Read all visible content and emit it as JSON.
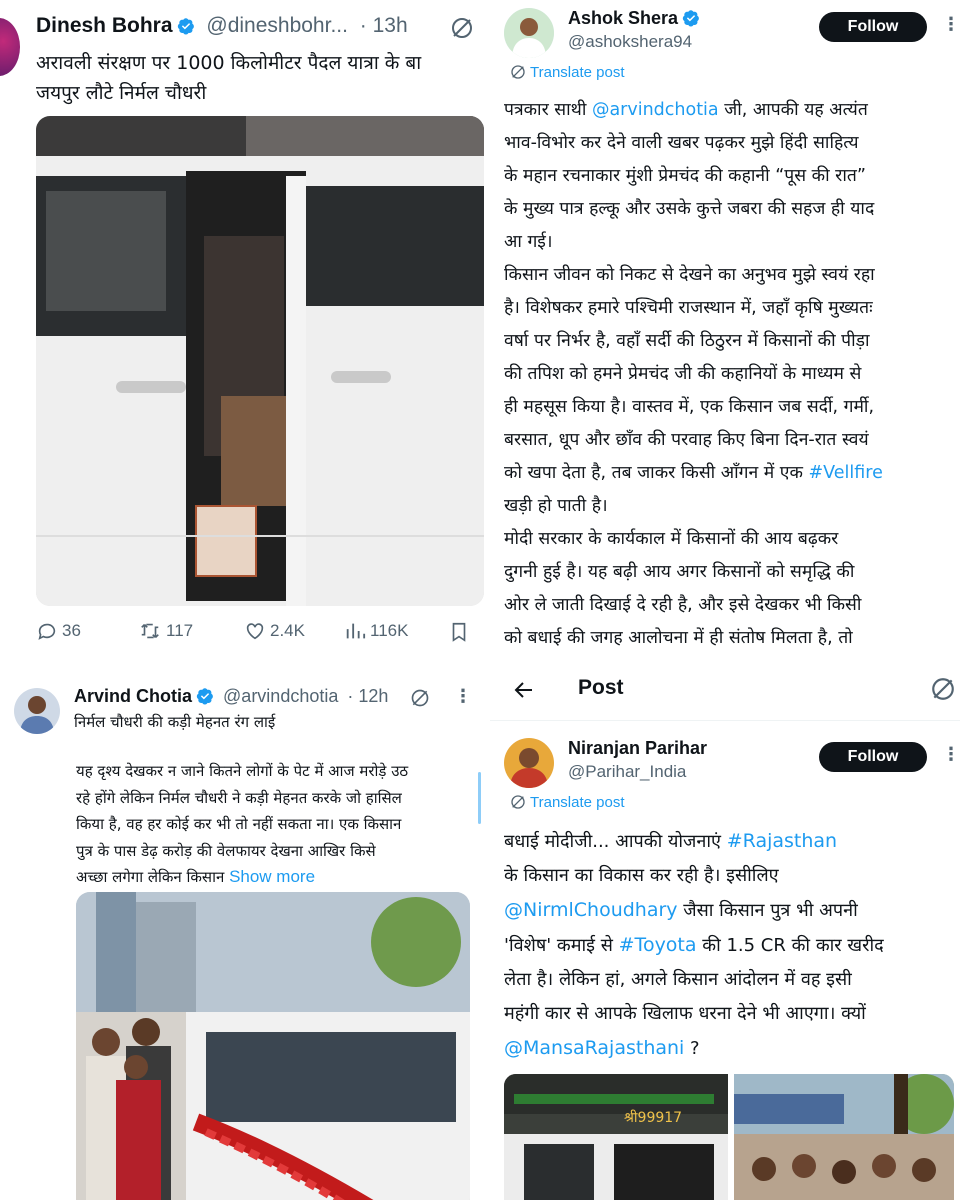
{
  "tweet1": {
    "name": "Dinesh Bohra",
    "handle": "@dineshbohr...",
    "time": "· 13h",
    "text_line1": "अरावली संरक्षण पर 1000 किलोमीटर पैदल यात्रा के बा",
    "text_line2": "जयपुर लौटे निर्मल चौधरी",
    "replies": "36",
    "reposts": "117",
    "likes": "2.4K",
    "views": "116K"
  },
  "tweet2": {
    "name": "Ashok Shera",
    "handle": "@ashokshera94",
    "follow": "Follow",
    "translate": "Translate post",
    "p1_l1_a": "पत्रकार साथी ",
    "p1_l1_link": "@arvindchotia",
    "p1_l1_b": " जी, आपकी यह अत्यंत",
    "p1_l2": "भाव-विभोर कर देने वाली खबर पढ़कर मुझे हिंदी साहित्य",
    "p1_l3": "के महान रचनाकार मुंशी प्रेमचंद की कहानी “पूस की रात”",
    "p1_l4": "के मुख्य पात्र हल्कू और उसके कुत्ते जबरा की सहज ही याद",
    "p1_l5": "आ गई।",
    "p2_l1": "किसान जीवन को निकट से देखने का अनुभव मुझे स्वयं रहा",
    "p2_l2": "है। विशेषकर हमारे पश्चिमी राजस्थान में, जहाँ कृषि मुख्यतः",
    "p2_l3": "वर्षा पर निर्भर है, वहाँ सर्दी की ठिठुरन में किसानों की पीड़ा",
    "p2_l4": "की तपिश को हमने प्रेमचंद जी की कहानियों के माध्यम से",
    "p2_l5": "ही महसूस किया है। वास्तव में, एक किसान जब सर्दी, गर्मी,",
    "p2_l6": "बरसात, धूप और छाँव की परवाह किए बिना दिन-रात स्वयं",
    "p2_l7_a": "को खपा देता है, तब जाकर किसी आँगन में एक ",
    "p2_l7_link": "#Vellfire",
    "p2_l8": "खड़ी हो पाती है।",
    "p3_l1": " मोदी सरकार के कार्यकाल में किसानों की आय बढ़कर",
    "p3_l2": "दुगनी हुई है। यह बढ़ी आय अगर किसानों को समृद्धि की",
    "p3_l3": "ओर ले जाती दिखाई दे रही है, और इसे देखकर भी किसी",
    "p3_l4": "को बधाई की जगह आलोचना में ही संतोष मिलता है, तो"
  },
  "tweet3": {
    "name": "Arvind Chotia",
    "handle": "@arvindchotia",
    "time": "· 12h",
    "title": "निर्मल चौधरी की कड़ी मेहनत रंग लाई",
    "l1": "यह दृश्य देखकर न जाने कितने लोगों के पेट में आज मरोड़े उठ",
    "l2": "रहे होंगे लेकिन निर्मल चौधरी ने कड़ी मेहनत करके जो हासिल",
    "l3": "किया है, वह हर कोई कर भी तो नहीं सकता ना। एक किसान",
    "l4": "पुत्र के पास डेढ़ करोड़ की वेलफायर देखना आखिर किसे",
    "l5": "अच्छा लगेगा लेकिन किसान ",
    "show_more": "Show more"
  },
  "tweet4": {
    "header": "Post",
    "name": "Niranjan Parihar",
    "handle": "@Parihar_India",
    "follow": "Follow",
    "translate": "Translate post",
    "l1_a": "बधाई मोदीजी... आपकी योजनाएं ",
    "l1_link": "#Rajasthan",
    "l2": "के किसान का विकास कर रही है। इसीलिए",
    "l3_link": "@NirmlChoudhary",
    "l3_b": " जैसा किसान पुत्र भी अपनी",
    "l4_a": "'विशेष' कमाई से ",
    "l4_link": "#Toyota",
    "l4_b": " की 1.5 CR की कार खरीद",
    "l5": "लेता है। लेकिन हां, अगले किसान आंदोलन में वह इसी",
    "l6": "महंगी कार से आपके खिलाफ धरना देने भी आएगा। क्यों",
    "l7_link": "@MansaRajasthani",
    "l7_b": " ?",
    "photo_sign": "श्री99917"
  },
  "colors": {
    "link": "#1d9bf0",
    "verified": "#1d9bf0",
    "text": "#0f1419",
    "muted": "#536471"
  }
}
